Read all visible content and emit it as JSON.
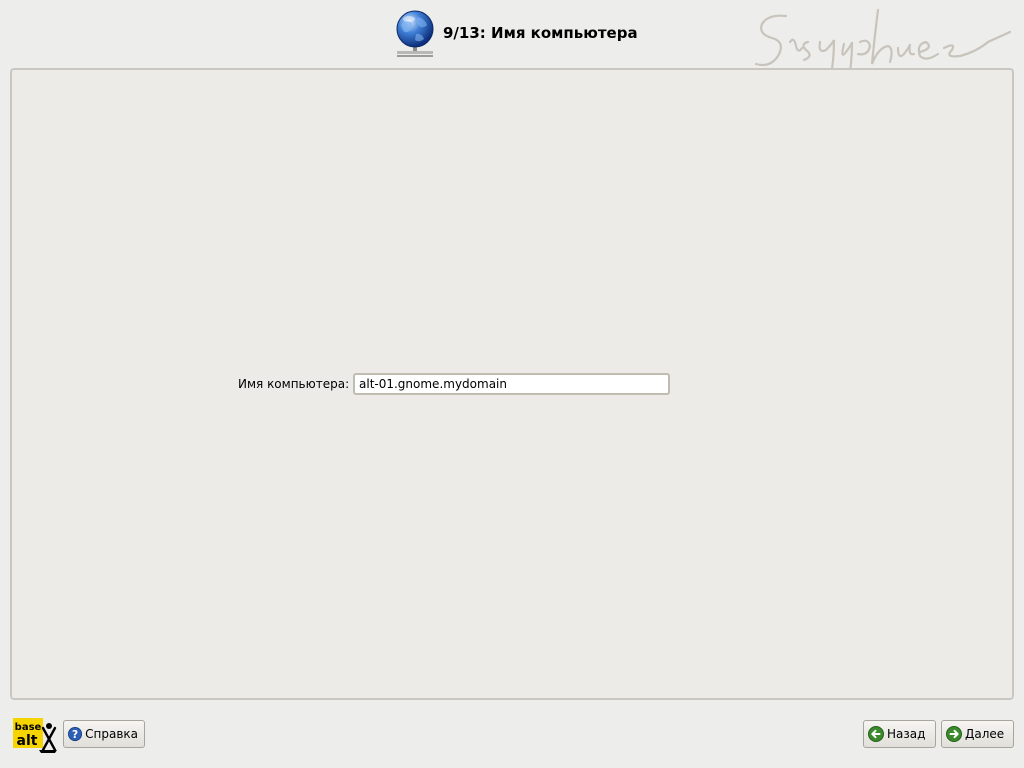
{
  "header": {
    "step_title": "9/13: Имя компьютера",
    "icon": "globe-network-icon",
    "watermark": "Sisyphus"
  },
  "form": {
    "hostname_label": "Имя компьютера:",
    "hostname_value": "alt-01.gnome.mydomain"
  },
  "footer": {
    "logo_text_top": "base",
    "logo_text_bottom": "alt",
    "help_label": "Справка",
    "help_icon": "help-icon",
    "back_label": "Назад",
    "back_icon": "arrow-left-icon",
    "next_label": "Далее",
    "next_icon": "arrow-right-icon"
  },
  "colors": {
    "background": "#ededeb",
    "panel": "#edebe7",
    "button_icon_green": "#3a8a2c",
    "help_icon_blue": "#2b5fb8",
    "logo_yellow": "#f5d400"
  }
}
